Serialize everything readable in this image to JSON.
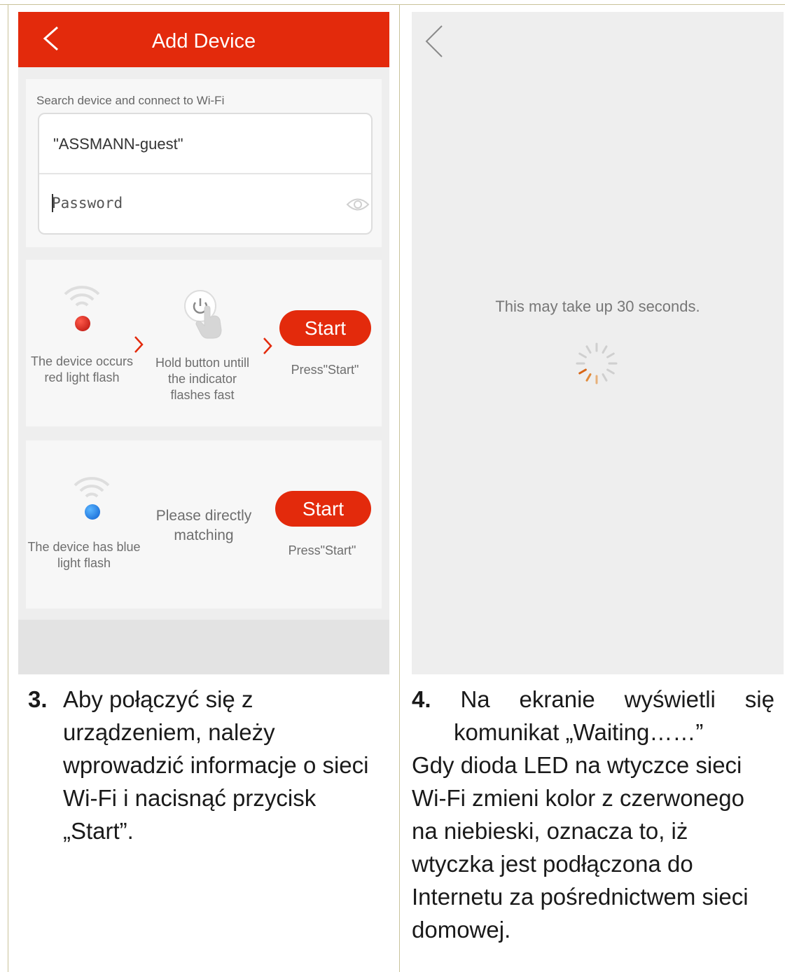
{
  "left_screen": {
    "header_title": "Add Device",
    "wifi_hint": "Search device and connect to Wi-Fi",
    "ssid_value": "\"ASSMANN-guest\"",
    "password_placeholder": "Password",
    "step_red": {
      "caption_device": "The device occurs red light flash",
      "caption_hold": "Hold button untill the indicator flashes fast",
      "start_label": "Start",
      "press_text": "Press\"Start\""
    },
    "step_blue": {
      "caption_device": "The device has blue light flash",
      "caption_direct": "Please directly matching",
      "start_label": "Start",
      "press_text": "Press\"Start\""
    }
  },
  "right_screen": {
    "wait_text": "This may take up 30 seconds."
  },
  "instructions": {
    "step3_num": "3.",
    "step3_text": "Aby połączyć się z urządzeniem, należy wprowadzić informacje o sieci Wi-Fi i nacisnąć przycisk „Start”.",
    "step4_num": "4.",
    "step4_words": [
      "Na",
      "ekranie",
      "wyświetli",
      "się"
    ],
    "step4_line2": "komunikat „Waiting……”",
    "step4_para": "Gdy dioda LED na wtyczce sieci Wi-Fi zmieni kolor z czerwonego na niebieski, oznacza to, iż wtyczka jest podłączona do Internetu za pośrednictwem sieci domowej."
  },
  "colors": {
    "accent_red": "#e32a0c",
    "led_red": "#c8140c",
    "led_blue": "#1e7fe6",
    "frame_line": "#c9c39a"
  }
}
